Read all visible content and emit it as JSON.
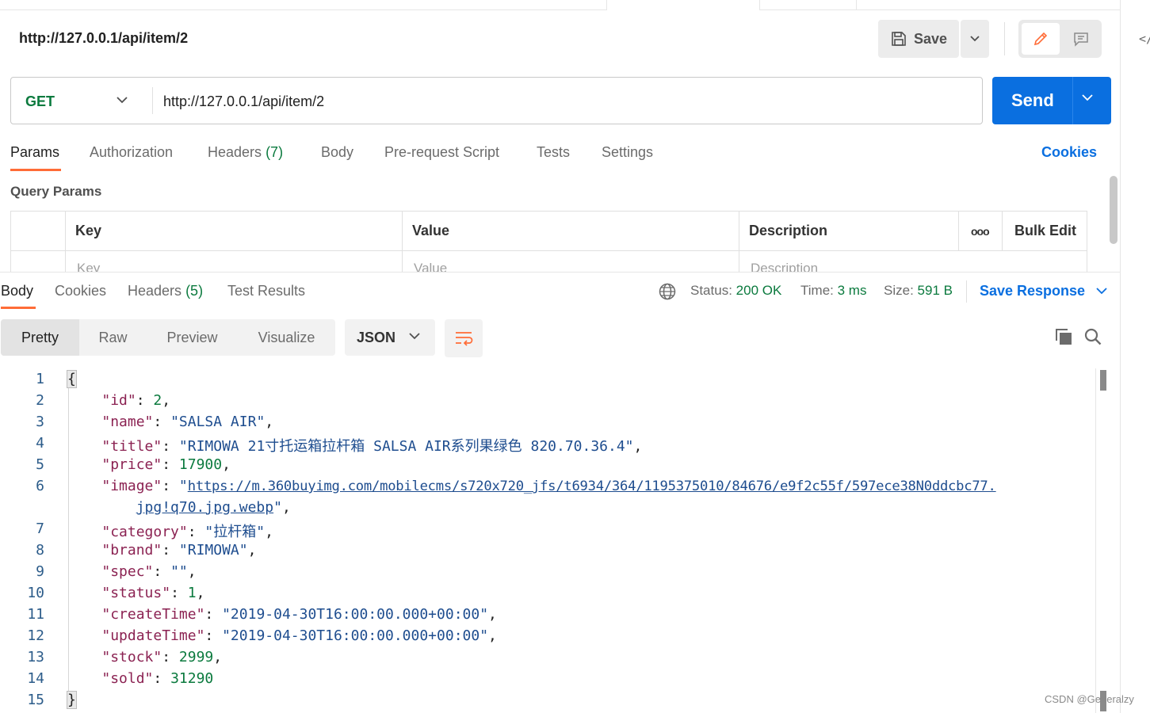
{
  "request": {
    "title": "http://127.0.0.1/api/item/2",
    "save_label": "Save",
    "method": "GET",
    "url": "http://127.0.0.1/api/item/2",
    "send_label": "Send"
  },
  "request_tabs": [
    {
      "label": "Params",
      "count": ""
    },
    {
      "label": "Authorization",
      "count": ""
    },
    {
      "label": "Headers",
      "count": "(7)"
    },
    {
      "label": "Body",
      "count": ""
    },
    {
      "label": "Pre-request Script",
      "count": ""
    },
    {
      "label": "Tests",
      "count": ""
    },
    {
      "label": "Settings",
      "count": ""
    }
  ],
  "cookies_link": "Cookies",
  "query_params": {
    "label": "Query Params",
    "columns": [
      "Key",
      "Value",
      "Description"
    ],
    "placeholders": [
      "Key",
      "Value",
      "Description"
    ],
    "bulk_edit": "Bulk Edit",
    "more": "ooo"
  },
  "response_tabs": [
    {
      "label": "Body",
      "count": ""
    },
    {
      "label": "Cookies",
      "count": ""
    },
    {
      "label": "Headers",
      "count": "(5)"
    },
    {
      "label": "Test Results",
      "count": ""
    }
  ],
  "response_status": {
    "status_label": "Status:",
    "status_value": "200 OK",
    "time_label": "Time:",
    "time_value": "3 ms",
    "size_label": "Size:",
    "size_value": "591 B",
    "save_response": "Save Response"
  },
  "view_modes": [
    "Pretty",
    "Raw",
    "Preview",
    "Visualize"
  ],
  "format": "JSON",
  "response_body": {
    "open_brace": "{",
    "close_brace": "}",
    "fields": [
      {
        "key": "\"id\"",
        "value": "2",
        "type": "n",
        "comma": ","
      },
      {
        "key": "\"name\"",
        "value": "\"SALSA AIR\"",
        "type": "s",
        "comma": ","
      },
      {
        "key": "\"title\"",
        "value": "\"RIMOWA 21寸托运箱拉杆箱 SALSA AIR系列果绿色 820.70.36.4\"",
        "type": "s",
        "comma": ","
      },
      {
        "key": "\"price\"",
        "value": "17900",
        "type": "n",
        "comma": ","
      },
      {
        "key": "\"image\"",
        "value_quote": "\"",
        "value_link1": "https://m.360buyimg.com/mobilecms/s720x720_jfs/t6934/364/1195375010/84676/e9f2c55f/597ece38N0ddcbc77.",
        "value_link2": "jpg!q70.jpg.webp",
        "type": "link",
        "comma": ","
      },
      {
        "key": "\"category\"",
        "value": "\"拉杆箱\"",
        "type": "s",
        "comma": ","
      },
      {
        "key": "\"brand\"",
        "value": "\"RIMOWA\"",
        "type": "s",
        "comma": ","
      },
      {
        "key": "\"spec\"",
        "value": "\"\"",
        "type": "s",
        "comma": ","
      },
      {
        "key": "\"status\"",
        "value": "1",
        "type": "n",
        "comma": ","
      },
      {
        "key": "\"createTime\"",
        "value": "\"2019-04-30T16:00:00.000+00:00\"",
        "type": "s",
        "comma": ","
      },
      {
        "key": "\"updateTime\"",
        "value": "\"2019-04-30T16:00:00.000+00:00\"",
        "type": "s",
        "comma": ","
      },
      {
        "key": "\"stock\"",
        "value": "2999",
        "type": "n",
        "comma": ","
      },
      {
        "key": "\"sold\"",
        "value": "31290",
        "type": "n",
        "comma": ""
      }
    ],
    "line_numbers": [
      "1",
      "2",
      "3",
      "4",
      "5",
      "6",
      "7",
      "8",
      "9",
      "10",
      "11",
      "12",
      "13",
      "14",
      "15"
    ]
  },
  "watermark": "CSDN @Generalzy",
  "colors": {
    "accent": "#0a6fe0",
    "tab_underline": "#ff6c37",
    "success": "#0b7a3e"
  }
}
